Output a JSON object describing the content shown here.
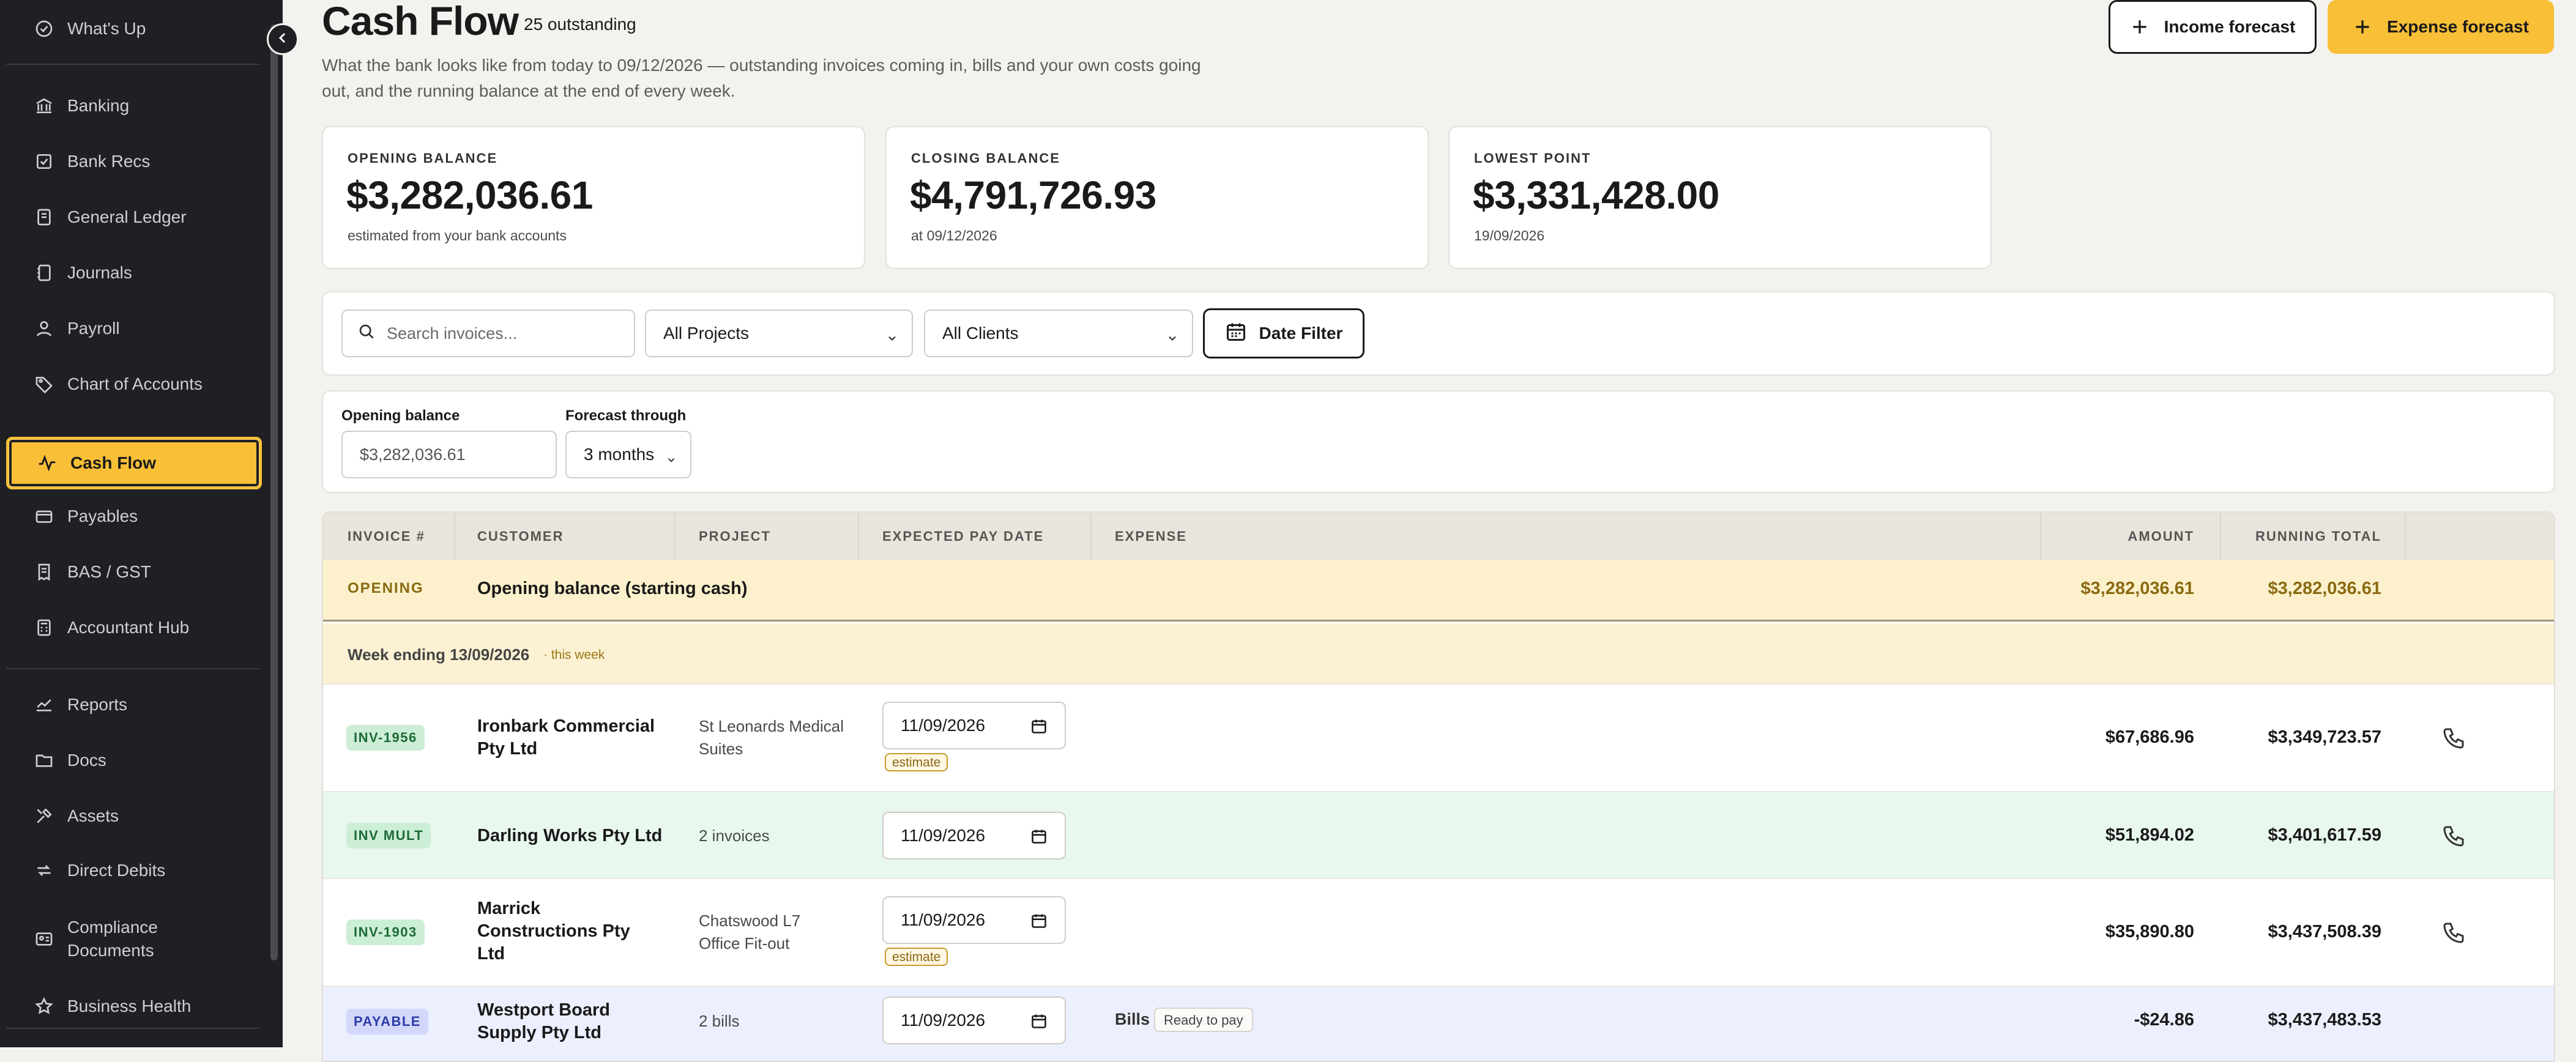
{
  "sidebar": {
    "items": [
      {
        "label": "What's Up",
        "icon": "circle-check-icon"
      },
      {
        "label": "Banking",
        "icon": "bank-icon"
      },
      {
        "label": "Bank Recs",
        "icon": "checkbox-icon"
      },
      {
        "label": "General Ledger",
        "icon": "book-icon"
      },
      {
        "label": "Journals",
        "icon": "notebook-icon"
      },
      {
        "label": "Payroll",
        "icon": "user-icon"
      },
      {
        "label": "Chart of Accounts",
        "icon": "tag-icon"
      },
      {
        "label": "Cash Flow",
        "icon": "pulse-icon",
        "active": true
      },
      {
        "label": "Payables",
        "icon": "wallet-icon"
      },
      {
        "label": "BAS / GST",
        "icon": "receipt-icon"
      },
      {
        "label": "Accountant Hub",
        "icon": "calculator-icon"
      },
      {
        "label": "Reports",
        "icon": "chart-line-icon"
      },
      {
        "label": "Docs",
        "icon": "folder-icon"
      },
      {
        "label": "Assets",
        "icon": "tools-icon"
      },
      {
        "label": "Direct Debits",
        "icon": "repeat-icon"
      },
      {
        "label": "Compliance Documents",
        "icon": "id-card-icon"
      },
      {
        "label": "Business Health",
        "icon": "star-icon"
      }
    ]
  },
  "header": {
    "title": "Cash Flow",
    "outstanding": "25 outstanding",
    "subtitle": "What the bank looks like from today to 09/12/2026 — outstanding invoices coming in, bills and your own costs going out, and the running balance at the end of every week.",
    "income_button": "Income forecast",
    "expense_button": "Expense forecast"
  },
  "cards": [
    {
      "label": "OPENING BALANCE",
      "value": "$3,282,036.61",
      "note": "estimated from your bank accounts"
    },
    {
      "label": "CLOSING BALANCE",
      "value": "$4,791,726.93",
      "note": "at 09/12/2026"
    },
    {
      "label": "LOWEST POINT",
      "value": "$3,331,428.00",
      "note": "19/09/2026"
    }
  ],
  "filters": {
    "search_placeholder": "Search invoices...",
    "projects": "All Projects",
    "clients": "All Clients",
    "date_filter": "Date Filter"
  },
  "options": {
    "opening_label": "Opening balance",
    "opening_placeholder": "$3,282,036.61",
    "forecast_label": "Forecast through",
    "forecast_value": "3 months"
  },
  "table": {
    "headers": [
      "INVOICE #",
      "CUSTOMER",
      "PROJECT",
      "EXPECTED PAY DATE",
      "EXPENSE",
      "AMOUNT",
      "RUNNING TOTAL"
    ],
    "opening": {
      "tag": "OPENING",
      "label": "Opening balance (starting cash)",
      "amount": "$3,282,036.61",
      "running": "$3,282,036.61"
    },
    "week": {
      "label": "Week ending 13/09/2026",
      "note": "· this week"
    },
    "rows": [
      {
        "badge": "INV-1956",
        "customer": "Ironbark Commercial Pty Ltd",
        "project": "St Leonards Medical Suites",
        "date": "11/09/2026",
        "estimate": "estimate",
        "amount": "$67,686.96",
        "running": "$3,349,723.57"
      },
      {
        "badge": "INV MULT",
        "customer": "Darling Works Pty Ltd",
        "project": "2 invoices",
        "date": "11/09/2026",
        "amount": "$51,894.02",
        "running": "$3,401,617.59"
      },
      {
        "badge": "INV-1903",
        "customer": "Marrick Constructions Pty Ltd",
        "project": "Chatswood L7 Office Fit-out",
        "date": "11/09/2026",
        "estimate": "estimate",
        "amount": "$35,890.80",
        "running": "$3,437,508.39"
      },
      {
        "badge": "PAYABLE",
        "customer": "Westport Board Supply Pty Ltd",
        "project": "2 bills",
        "date": "11/09/2026",
        "expense": "Bills",
        "status": "Ready to pay",
        "amount": "-$24.86",
        "running": "$3,437,483.53"
      }
    ]
  },
  "colors": {
    "accent": "#f8bf37",
    "sidebar": "#1f2024",
    "opening_row": "#fcf1cc",
    "income_row": "#e9f8ee",
    "payable_row": "#eceffd"
  }
}
